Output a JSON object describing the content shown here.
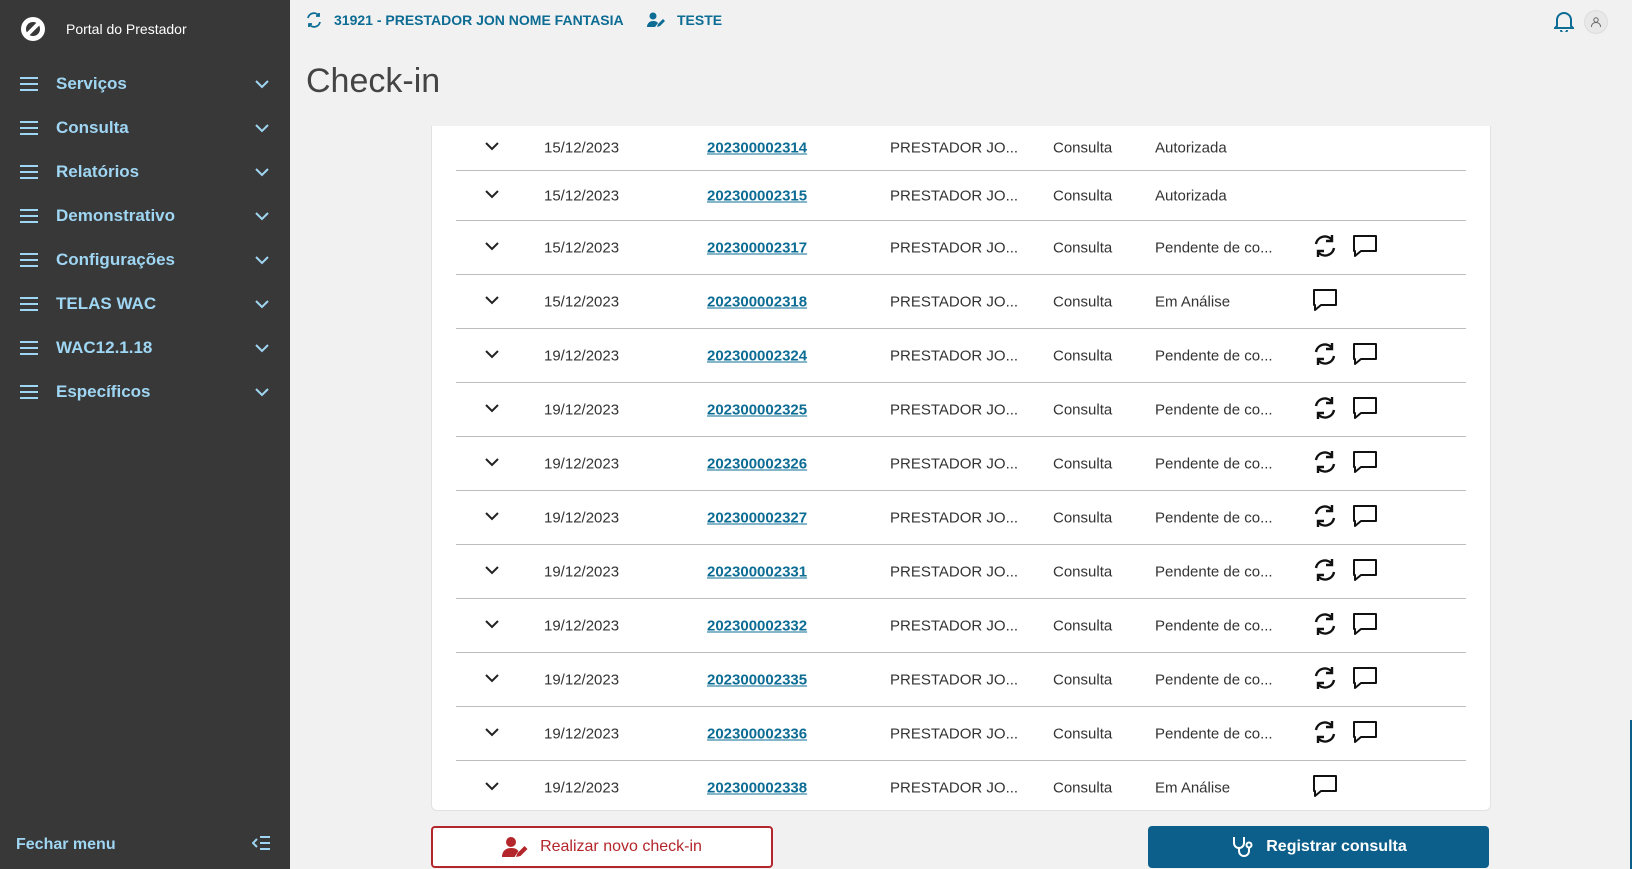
{
  "brand": {
    "title": "Portal do Prestador"
  },
  "sidebar": {
    "items": [
      {
        "label": "Serviços"
      },
      {
        "label": "Consulta"
      },
      {
        "label": "Relatórios"
      },
      {
        "label": "Demonstrativo"
      },
      {
        "label": "Configurações"
      },
      {
        "label": "TELAS WAC"
      },
      {
        "label": "WAC12.1.18"
      },
      {
        "label": "Específicos"
      }
    ],
    "close_label": "Fechar menu"
  },
  "topbar": {
    "provider": "31921 - PRESTADOR JON NOME FANTASIA",
    "user": "TESTE"
  },
  "page": {
    "title": "Check-in"
  },
  "table": {
    "rows": [
      {
        "date": "15/12/2023",
        "number": "202300002314",
        "provider": "PRESTADOR JO...",
        "type": "Consulta",
        "status": "Autorizada",
        "actions": []
      },
      {
        "date": "15/12/2023",
        "number": "202300002315",
        "provider": "PRESTADOR JO...",
        "type": "Consulta",
        "status": "Autorizada",
        "actions": []
      },
      {
        "date": "15/12/2023",
        "number": "202300002317",
        "provider": "PRESTADOR JO...",
        "type": "Consulta",
        "status": "Pendente de co...",
        "actions": [
          "refresh",
          "comment"
        ]
      },
      {
        "date": "15/12/2023",
        "number": "202300002318",
        "provider": "PRESTADOR JO...",
        "type": "Consulta",
        "status": "Em Análise",
        "actions": [
          "comment"
        ]
      },
      {
        "date": "19/12/2023",
        "number": "202300002324",
        "provider": "PRESTADOR JO...",
        "type": "Consulta",
        "status": "Pendente de co...",
        "actions": [
          "refresh",
          "comment"
        ]
      },
      {
        "date": "19/12/2023",
        "number": "202300002325",
        "provider": "PRESTADOR JO...",
        "type": "Consulta",
        "status": "Pendente de co...",
        "actions": [
          "refresh",
          "comment"
        ]
      },
      {
        "date": "19/12/2023",
        "number": "202300002326",
        "provider": "PRESTADOR JO...",
        "type": "Consulta",
        "status": "Pendente de co...",
        "actions": [
          "refresh",
          "comment"
        ]
      },
      {
        "date": "19/12/2023",
        "number": "202300002327",
        "provider": "PRESTADOR JO...",
        "type": "Consulta",
        "status": "Pendente de co...",
        "actions": [
          "refresh",
          "comment"
        ]
      },
      {
        "date": "19/12/2023",
        "number": "202300002331",
        "provider": "PRESTADOR JO...",
        "type": "Consulta",
        "status": "Pendente de co...",
        "actions": [
          "refresh",
          "comment"
        ]
      },
      {
        "date": "19/12/2023",
        "number": "202300002332",
        "provider": "PRESTADOR JO...",
        "type": "Consulta",
        "status": "Pendente de co...",
        "actions": [
          "refresh",
          "comment"
        ]
      },
      {
        "date": "19/12/2023",
        "number": "202300002335",
        "provider": "PRESTADOR JO...",
        "type": "Consulta",
        "status": "Pendente de co...",
        "actions": [
          "refresh",
          "comment"
        ]
      },
      {
        "date": "19/12/2023",
        "number": "202300002336",
        "provider": "PRESTADOR JO...",
        "type": "Consulta",
        "status": "Pendente de co...",
        "actions": [
          "refresh",
          "comment"
        ]
      },
      {
        "date": "19/12/2023",
        "number": "202300002338",
        "provider": "PRESTADOR JO...",
        "type": "Consulta",
        "status": "Em Análise",
        "actions": [
          "comment"
        ]
      }
    ]
  },
  "buttons": {
    "new_checkin": "Realizar novo check-in",
    "register": "Registrar consulta"
  },
  "colors": {
    "sidebar_bg": "#383838",
    "menu_text": "#9fd6f3",
    "link": "#0c6c94",
    "danger": "#b3262b",
    "primary": "#0c5f8a"
  }
}
